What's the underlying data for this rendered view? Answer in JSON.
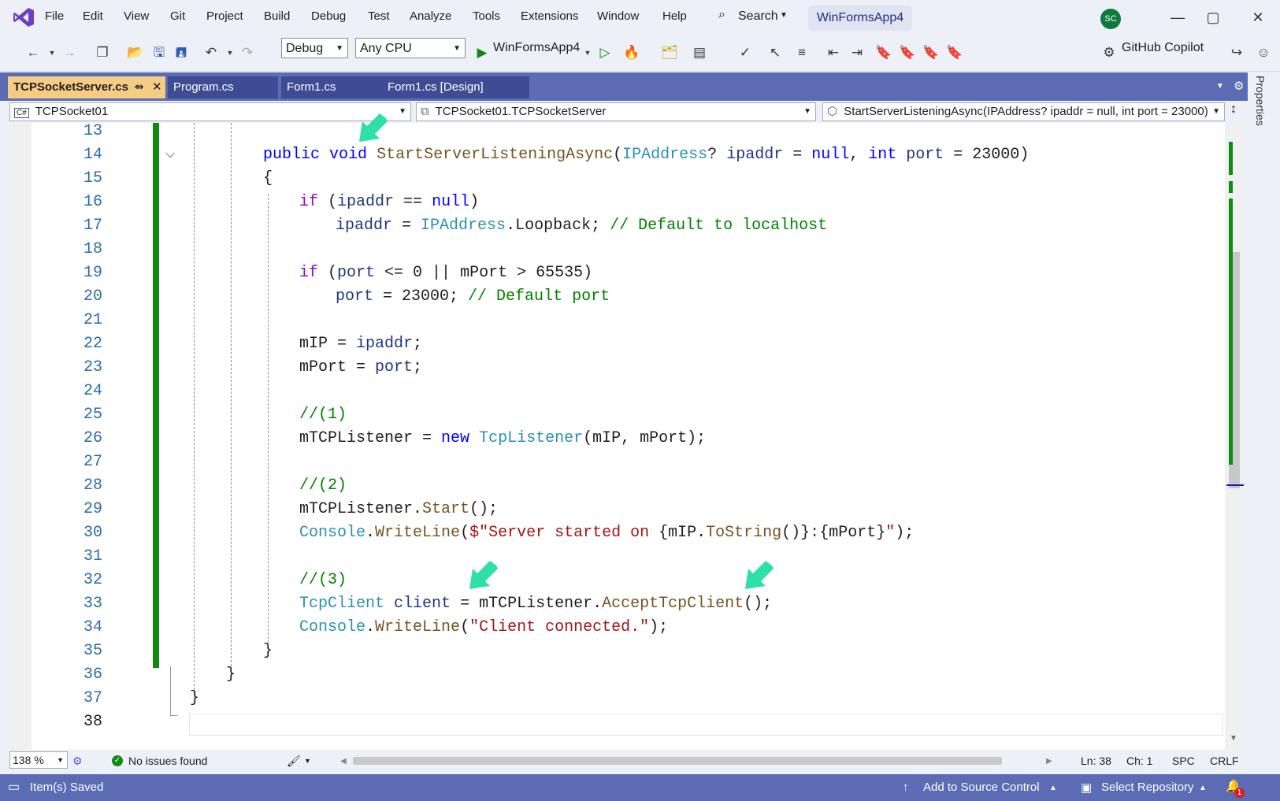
{
  "menu": {
    "items": [
      "File",
      "Edit",
      "View",
      "Git",
      "Project",
      "Build",
      "Debug",
      "Test",
      "Analyze",
      "Tools",
      "Extensions",
      "Window",
      "Help"
    ],
    "search_label": "Search",
    "project_name": "WinFormsApp4",
    "avatar_initials": "SC"
  },
  "toolbar": {
    "configuration": "Debug",
    "platform": "Any CPU",
    "startup_project": "WinFormsApp4",
    "copilot_label": "GitHub Copilot"
  },
  "tabs": [
    {
      "label": "TCPSocketServer.cs",
      "active": true
    },
    {
      "label": "Program.cs",
      "active": false
    },
    {
      "label": "Form1.cs",
      "active": false
    },
    {
      "label": "Form1.cs [Design]",
      "active": false
    }
  ],
  "navbar": {
    "project": "TCPSocket01",
    "class": "TCPSocket01.TCPSocketServer",
    "member": "StartServerListeningAsync(IPAddress? ipaddr = null, int port = 23000)"
  },
  "properties_label": "Properties",
  "editor": {
    "line_numbers": [
      "13",
      "14",
      "15",
      "16",
      "17",
      "18",
      "19",
      "20",
      "21",
      "22",
      "23",
      "24",
      "25",
      "26",
      "27",
      "28",
      "29",
      "30",
      "31",
      "32",
      "33",
      "34",
      "35",
      "36",
      "37",
      "38"
    ],
    "code": {
      "l14": [
        "public",
        " ",
        "void",
        " ",
        "StartServerListeningAsync",
        "(",
        "IPAddress",
        "? ",
        "ipaddr",
        " = ",
        "null",
        ", ",
        "int",
        " ",
        "port",
        " = 23000)"
      ],
      "l15": "{",
      "l16": [
        "if",
        " (",
        "ipaddr",
        " == ",
        "null",
        ")"
      ],
      "l17": [
        "ipaddr",
        " = ",
        "IPAddress",
        ".Loopback; ",
        "// Default to localhost"
      ],
      "l19": [
        "if",
        " (",
        "port",
        " <= 0 || mPort > 65535)"
      ],
      "l20": [
        "port",
        " = 23000; ",
        "// Default port"
      ],
      "l22": [
        "mIP = ",
        "ipaddr",
        ";"
      ],
      "l23": [
        "mPort = ",
        "port",
        ";"
      ],
      "l25": "//(1)",
      "l26": [
        "mTCPListener = ",
        "new",
        " ",
        "TcpListener",
        "(mIP, mPort);"
      ],
      "l28": "//(2)",
      "l29": [
        "mTCPListener.",
        "Start",
        "();"
      ],
      "l30": [
        "Console",
        ".",
        "WriteLine",
        "(",
        "$\"Server started on ",
        "{mIP.",
        "ToString",
        "()}",
        ":",
        "{mPort}",
        "\"",
        ");"
      ],
      "l32": "//(3)",
      "l33": [
        "TcpClient",
        " ",
        "client",
        " = mTCPListener.",
        "AcceptTcpClient",
        "();"
      ],
      "l34": [
        "Console",
        ".",
        "WriteLine",
        "(",
        "\"Client connected.\"",
        ");"
      ],
      "l35": "}",
      "l36": "}",
      "l37": "}"
    }
  },
  "editor_status": {
    "zoom": "138 %",
    "issues": "No issues found",
    "line": "Ln: 38",
    "char": "Ch: 1",
    "spacing": "SPC",
    "line_ending": "CRLF"
  },
  "statusbar": {
    "message": "Item(s) Saved",
    "source_control": "Add to Source Control",
    "repository": "Select Repository",
    "notification_count": "1"
  },
  "colors": {
    "accent": "#5b6cb4",
    "active_tab": "#f5cc84",
    "change_bar": "#108a10",
    "highlight_arrow": "#2ee0a8"
  }
}
